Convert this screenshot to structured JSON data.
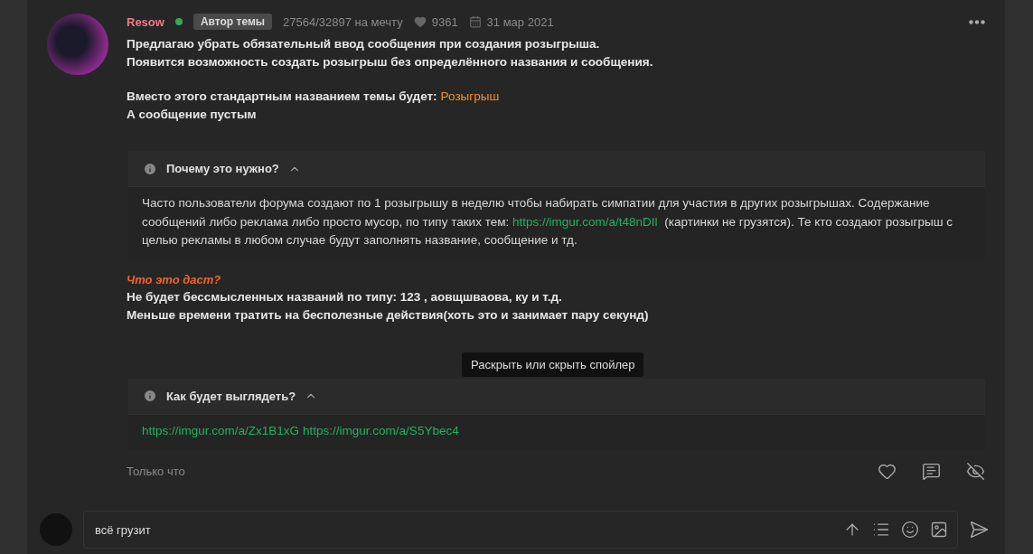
{
  "post": {
    "author": "Resow",
    "online": true,
    "badge": "Автор темы",
    "progress": "27564/32897 на мечту",
    "likes": "9361",
    "date": "31 мар 2021",
    "blocks": [
      {
        "kind": "paragraph",
        "lines": [
          {
            "text": "Предлагаю убрать обязательный ввод сообщения при создания розыгрыша."
          },
          {
            "text": "Появится возможность создать розыгрыш без определённого названия и сообщения."
          }
        ]
      },
      {
        "kind": "paragraph",
        "lines": [
          {
            "text": "Вместо этого стандартным названием темы будет:",
            "accent": "Розыгрыш"
          },
          {
            "text": "А сообщение пустым"
          }
        ]
      },
      {
        "kind": "spoiler",
        "title": "Почему это нужно?",
        "expanded": true,
        "content": [
          {
            "kind": "text",
            "text": "Часто пользователи форума создают по 1 розыгрышу в неделю чтобы набирать симпатии для участия в других розыгрышах. Содержание сообщений либо реклама либо просто мусор, по типу таких тем: "
          },
          {
            "kind": "link",
            "text": "https://imgur.com/a/t48nDIl"
          },
          {
            "kind": "text",
            "text": " (картинки не грузятся). Те кто создают розыгрыш с целью рекламы в любом случае будут заполнять название, сообщение и тд."
          }
        ]
      },
      {
        "kind": "section",
        "heading": "Что это даст?",
        "lines": [
          "Не будет бессмысленных названий по типу: 123 , аовщшваова, ку и т.д.",
          "Меньше времени тратить на бесполезные действия(хоть это и занимает пару секунд)"
        ]
      },
      {
        "kind": "spoiler",
        "title": "Как будет выглядеть?",
        "expanded": true,
        "tooltip": "Раскрыть или скрыть спойлер",
        "content": [
          {
            "kind": "link",
            "text": "https://imgur.com/a/Zx1B1xG"
          },
          {
            "kind": "link",
            "text": "https://imgur.com/a/S5Ybec4"
          }
        ]
      }
    ],
    "time": "Только что"
  },
  "reply": {
    "value": "всё грузит"
  }
}
